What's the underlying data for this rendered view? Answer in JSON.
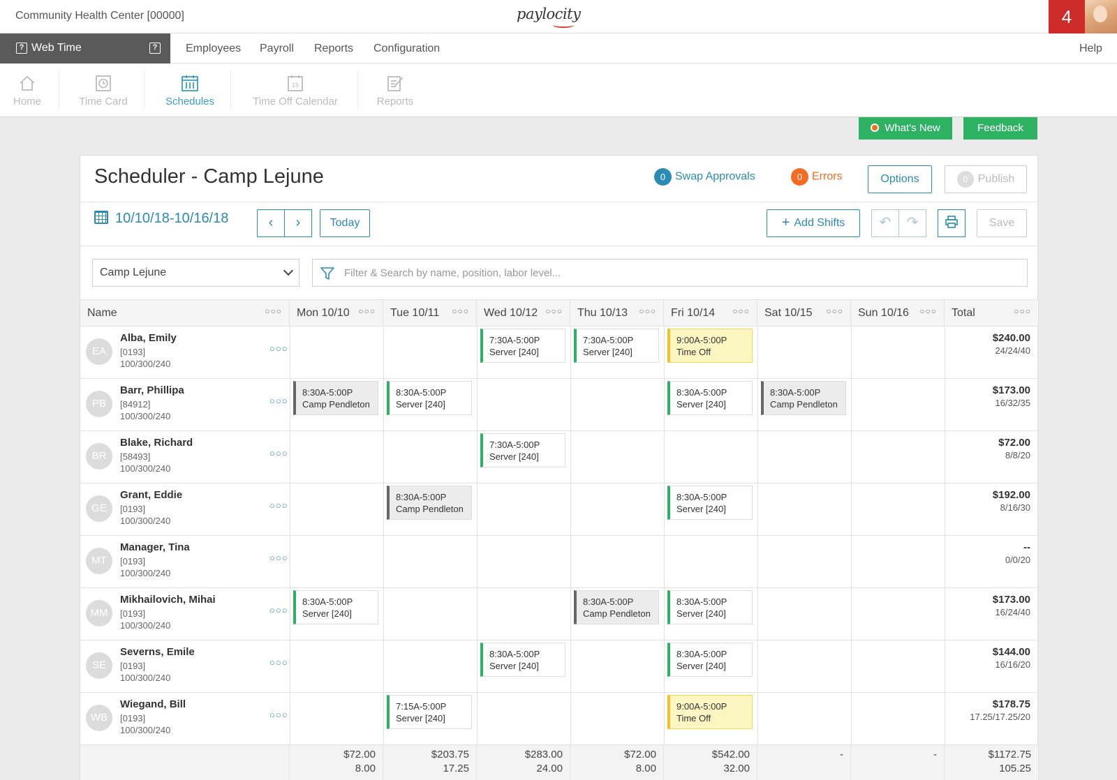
{
  "header": {
    "company": "Community Health Center [00000]",
    "logo": "paylocity",
    "notifications": "4"
  },
  "nav": {
    "app": "Web Time",
    "links": [
      "Employees",
      "Payroll",
      "Reports",
      "Configuration"
    ],
    "help": "Help"
  },
  "subnav": {
    "items": [
      {
        "label": "Home",
        "icon": "home-icon"
      },
      {
        "label": "Time Card",
        "icon": "clock-icon"
      },
      {
        "label": "Schedules",
        "icon": "schedule-icon"
      },
      {
        "label": "Time Off Calendar",
        "icon": "calendar-icon"
      },
      {
        "label": "Reports",
        "icon": "reports-icon"
      }
    ],
    "active": "Schedules"
  },
  "actions": {
    "whats_new": "What's New",
    "feedback": "Feedback"
  },
  "scheduler": {
    "title": "Scheduler - Camp Lejune",
    "swap_count": "0",
    "swap_label": "Swap Approvals",
    "error_count": "0",
    "error_label": "Errors",
    "options": "Options",
    "publish_count": "0",
    "publish": "Publish",
    "date_range": "10/10/18-10/16/18",
    "today": "Today",
    "add_shifts": "Add Shifts",
    "save": "Save",
    "location": "Camp Lejune",
    "search_placeholder": "Filter & Search by name, position, labor level..."
  },
  "columns": [
    "Name",
    "Mon 10/10",
    "Tue 10/11",
    "Wed 10/12",
    "Thu 10/13",
    "Fri 10/14",
    "Sat 10/15",
    "Sun 10/16",
    "Total"
  ],
  "employees": [
    {
      "initials": "EA",
      "name": "Alba, Emily",
      "id": "[0193]",
      "labor": "100/300/240",
      "total": "$240.00",
      "hours": "24/24/40",
      "shifts": [
        {
          "day": 2,
          "time": "7:30A-5:00P",
          "desc": "Server [240]",
          "kind": "std"
        },
        {
          "day": 3,
          "time": "7:30A-5:00P",
          "desc": "Server [240]",
          "kind": "std"
        },
        {
          "day": 4,
          "time": "9:00A-5:00P",
          "desc": "Time Off",
          "kind": "off"
        }
      ]
    },
    {
      "initials": "PB",
      "name": "Barr, Phillipa",
      "id": "[84912]",
      "labor": "100/300/240",
      "total": "$173.00",
      "hours": "16/32/35",
      "shifts": [
        {
          "day": 0,
          "time": "8:30A-5:00P",
          "desc": "Camp Pendleton",
          "kind": "pend"
        },
        {
          "day": 1,
          "time": "8:30A-5:00P",
          "desc": "Server [240]",
          "kind": "std"
        },
        {
          "day": 4,
          "time": "8:30A-5:00P",
          "desc": "Server [240]",
          "kind": "std"
        },
        {
          "day": 5,
          "time": "8:30A-5:00P",
          "desc": "Camp Pendleton",
          "kind": "pend"
        }
      ]
    },
    {
      "initials": "BR",
      "name": "Blake, Richard",
      "id": "[58493]",
      "labor": "100/300/240",
      "total": "$72.00",
      "hours": "8/8/20",
      "shifts": [
        {
          "day": 2,
          "time": "7:30A-5:00P",
          "desc": "Server [240]",
          "kind": "std"
        }
      ]
    },
    {
      "initials": "GE",
      "name": "Grant, Eddie",
      "id": "[0193]",
      "labor": "100/300/240",
      "total": "$192.00",
      "hours": "8/16/30",
      "shifts": [
        {
          "day": 1,
          "time": "8:30A-5:00P",
          "desc": "Camp Pendleton",
          "kind": "pend"
        },
        {
          "day": 4,
          "time": "8:30A-5:00P",
          "desc": "Server [240]",
          "kind": "std"
        }
      ]
    },
    {
      "initials": "MT",
      "name": "Manager, Tina",
      "id": "[0193]",
      "labor": "100/300/240",
      "total": "--",
      "hours": "0/0/20",
      "shifts": []
    },
    {
      "initials": "MM",
      "name": "Mikhailovich, Mihai",
      "id": "[0193]",
      "labor": "100/300/240",
      "total": "$173.00",
      "hours": "16/24/40",
      "shifts": [
        {
          "day": 0,
          "time": "8:30A-5:00P",
          "desc": "Server [240]",
          "kind": "std"
        },
        {
          "day": 3,
          "time": "8:30A-5:00P",
          "desc": "Camp Pendleton",
          "kind": "pend"
        },
        {
          "day": 4,
          "time": "8:30A-5:00P",
          "desc": "Server [240]",
          "kind": "std"
        }
      ]
    },
    {
      "initials": "SE",
      "name": "Severns, Emile",
      "id": "[0193]",
      "labor": "100/300/240",
      "total": "$144.00",
      "hours": "16/16/20",
      "shifts": [
        {
          "day": 2,
          "time": "8:30A-5:00P",
          "desc": "Server [240]",
          "kind": "std"
        },
        {
          "day": 4,
          "time": "8:30A-5:00P",
          "desc": "Server [240]",
          "kind": "std"
        }
      ]
    },
    {
      "initials": "WB",
      "name": "Wiegand, Bill",
      "id": "[0193]",
      "labor": "100/300/240",
      "total": "$178.75",
      "hours": "17.25/17.25/20",
      "shifts": [
        {
          "day": 1,
          "time": "7:15A-5:00P",
          "desc": "Server [240]",
          "kind": "std"
        },
        {
          "day": 4,
          "time": "9:00A-5:00P",
          "desc": "Time Off",
          "kind": "off"
        }
      ]
    }
  ],
  "footer": [
    {
      "amount": "$72.00",
      "hours": "8.00"
    },
    {
      "amount": "$203.75",
      "hours": "17.25"
    },
    {
      "amount": "$283.00",
      "hours": "24.00"
    },
    {
      "amount": "$72.00",
      "hours": "8.00"
    },
    {
      "amount": "$542.00",
      "hours": "32.00"
    },
    {
      "amount": "-",
      "hours": ""
    },
    {
      "amount": "-",
      "hours": ""
    },
    {
      "amount": "$1172.75",
      "hours": "105.25"
    }
  ],
  "colors": {
    "accent": "#2a8bb4",
    "green": "#2fb163",
    "orange": "#f36c21",
    "red": "#cf2b2b",
    "timeoff": "#fbf6c2"
  }
}
